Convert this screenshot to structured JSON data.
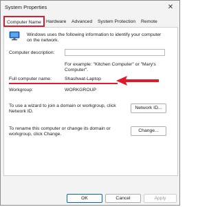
{
  "window": {
    "title": "System Properties",
    "close_glyph": "✕"
  },
  "tabs": [
    {
      "label": "Computer Name",
      "active": true
    },
    {
      "label": "Hardware"
    },
    {
      "label": "Advanced"
    },
    {
      "label": "System Protection"
    },
    {
      "label": "Remote"
    }
  ],
  "intro": {
    "line1": "Windows uses the following information to identify your computer",
    "line2": "on the network.",
    "icon": "monitor-icon"
  },
  "description": {
    "label": "Computer description:",
    "value": "",
    "hint_line1": "For example: \"Kitchen Computer\" or \"Mary's",
    "hint_line2": "Computer\"."
  },
  "full_name": {
    "label": "Full computer name:",
    "value": "Shashwat-Laptop"
  },
  "workgroup": {
    "label": "Workgroup:",
    "value": "WORKGROUP"
  },
  "network_id": {
    "text_line1": "To use a wizard to join a domain or workgroup, click",
    "text_line2": "Network ID.",
    "button": "Network ID..."
  },
  "change": {
    "text_line1": "To rename this computer or change its domain or",
    "text_line2": "workgroup, click Change.",
    "button": "Change..."
  },
  "footer": {
    "ok": "OK",
    "cancel": "Cancel",
    "apply": "Apply"
  },
  "annotation_color": "#e0192b"
}
